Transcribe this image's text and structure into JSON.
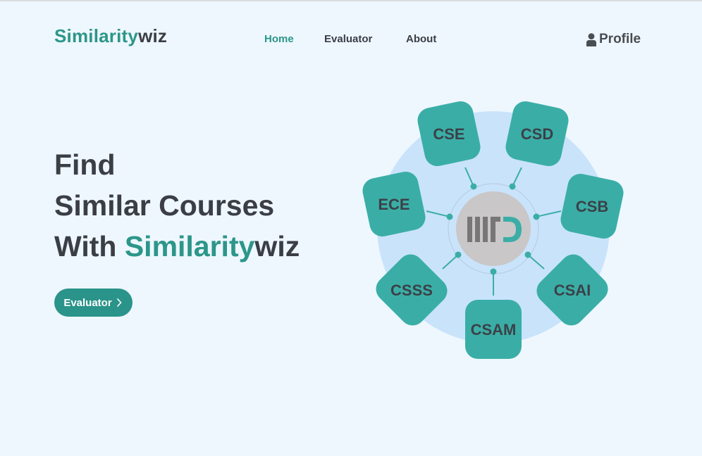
{
  "brand": {
    "part1": "Similarity",
    "part2": "wiz"
  },
  "nav": {
    "home": "Home",
    "evaluator": "Evaluator",
    "about": "About",
    "profile": "Profile"
  },
  "hero": {
    "line1": "Find",
    "line2": "Similar Courses",
    "line3_prefix": "With ",
    "line3_accent": "Similarity",
    "line3_suffix": "wiz"
  },
  "cta": {
    "label": "Evaluator"
  },
  "diagram": {
    "center_logo": "IIITD logo",
    "courses": [
      "CSE",
      "CSD",
      "ECE",
      "CSB",
      "CSSS",
      "CSAI",
      "CSAM"
    ]
  },
  "colors": {
    "accent": "#2c968a",
    "badge": "#3aaea6",
    "text": "#3b3e44",
    "bg": "#eef7fe",
    "circle": "#c9e3fb"
  },
  "icons": {
    "profile": "user-icon",
    "cta": "chevron-right-icon"
  }
}
